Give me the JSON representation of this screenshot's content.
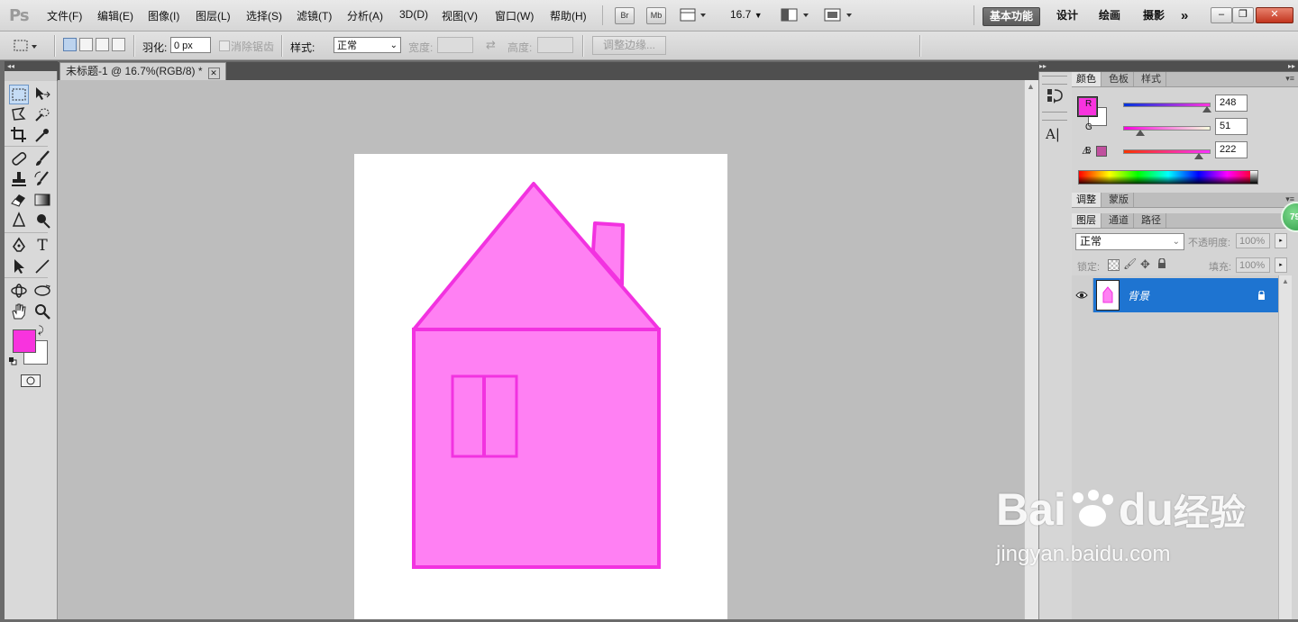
{
  "app": {
    "logo": "Ps",
    "menus": [
      "文件(F)",
      "编辑(E)",
      "图像(I)",
      "图层(L)",
      "选择(S)",
      "滤镜(T)",
      "分析(A)",
      "3D(D)",
      "视图(V)",
      "窗口(W)",
      "帮助(H)"
    ],
    "bridge_label": "Br",
    "minibridge_label": "Mb",
    "zoom": "16.7",
    "workspaces": [
      "基本功能",
      "设计",
      "绘画",
      "摄影"
    ],
    "workspace_more": "»",
    "colors": {
      "brand_blue": "#1e74d1",
      "foreground": "#f833de",
      "house_fill": "#ff80f3",
      "house_stroke": "#f232e0"
    }
  },
  "options": {
    "feather_label": "羽化:",
    "feather_value": "0 px",
    "antialias_label": "消除锯齿",
    "style_label": "样式:",
    "style_value": "正常",
    "width_label": "宽度:",
    "height_label": "高度:",
    "refine_label": "调整边缘..."
  },
  "document": {
    "tab_title": "未标题-1 @ 16.7%(RGB/8) *",
    "close_glyph": "✕"
  },
  "color_panel": {
    "tabs": [
      "颜色",
      "色板",
      "样式"
    ],
    "channels": [
      {
        "label": "R",
        "value": "248"
      },
      {
        "label": "G",
        "value": "51"
      },
      {
        "label": "B",
        "value": "222"
      }
    ]
  },
  "adjust_panel": {
    "tabs": [
      "调整",
      "蒙版"
    ]
  },
  "layers_panel": {
    "tabs": [
      "图层",
      "通道",
      "路径"
    ],
    "blend_mode": "正常",
    "opacity_label": "不透明度:",
    "opacity_value": "100%",
    "lock_label": "锁定:",
    "fill_label": "填充:",
    "fill_value": "100%",
    "layers": [
      {
        "name": "背景",
        "visible": true,
        "locked": true
      }
    ]
  },
  "overlay": {
    "badge": "79",
    "watermark_brand": "Bai",
    "watermark_brand2": "du",
    "watermark_suffix": "经验",
    "watermark_url": "jingyan.baidu.com"
  }
}
